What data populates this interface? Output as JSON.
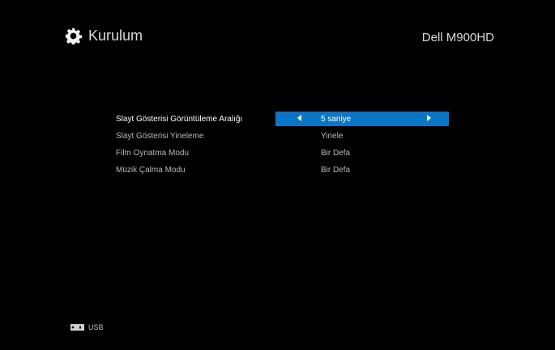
{
  "header": {
    "title": "Kurulum",
    "icon": "gear-icon",
    "model": "Dell M900HD"
  },
  "settings": [
    {
      "label": "Slayt Gösterisi Görüntüleme Aralığı",
      "value": "5 saniye",
      "selected": true
    },
    {
      "label": "Slayt Gösterisi Yineleme",
      "value": "Yinele",
      "selected": false
    },
    {
      "label": "Film Oynatma Modu",
      "value": "Bir Defa",
      "selected": false
    },
    {
      "label": "Müzik Çalma Modu",
      "value": "Bir Defa",
      "selected": false
    }
  ],
  "footer": {
    "source_icon": "usb-icon",
    "source": "USB"
  },
  "colors": {
    "background": "#000000",
    "selection": "#0b76c6",
    "text": "#d9d9d9"
  }
}
